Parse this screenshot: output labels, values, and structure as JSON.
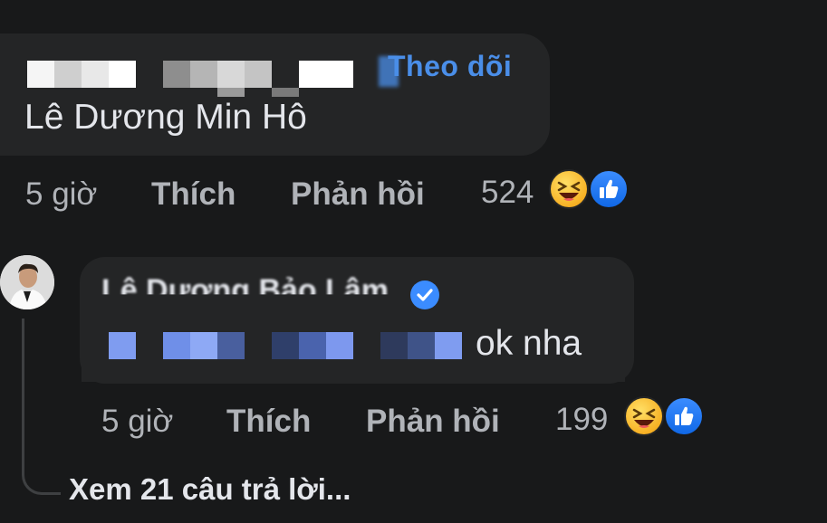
{
  "comment": {
    "follow_label": "Theo dõi",
    "text": "Lê Dương Min Hô",
    "time": "5 giờ",
    "like_label": "Thích",
    "reply_label": "Phản hồi",
    "reaction_count": "524",
    "reactions": [
      "haha-icon",
      "like-icon"
    ]
  },
  "reply": {
    "author": "Lê Dương Bảo Lâm",
    "text": "ok nha",
    "time": "5 giờ",
    "like_label": "Thích",
    "reply_label": "Phản hồi",
    "reaction_count": "199",
    "reactions": [
      "haha-icon",
      "like-icon"
    ]
  },
  "view_replies_label": "Xem 21 câu trả lời...",
  "colors": {
    "background": "#18191a",
    "bubble": "#242526",
    "link_blue": "#4a8ee8",
    "muted_text": "#b0b3b8"
  }
}
